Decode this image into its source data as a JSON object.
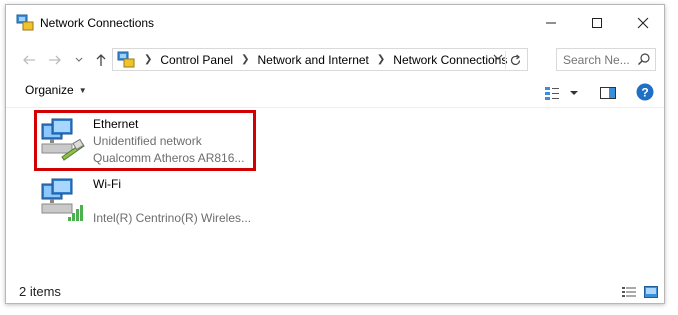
{
  "window": {
    "title": "Network Connections",
    "minimize_icon": "minimize-icon",
    "maximize_icon": "maximize-icon",
    "close_icon": "close-icon"
  },
  "navigation": {
    "back_icon": "arrow-left-icon",
    "forward_icon": "arrow-right-icon",
    "up_icon": "arrow-up-icon"
  },
  "address_bar": {
    "breadcrumbs": [
      "Control Panel",
      "Network and Internet",
      "Network Connections"
    ],
    "refresh_icon": "refresh-icon"
  },
  "search": {
    "placeholder": "Search Ne..."
  },
  "toolbar": {
    "organize_label": "Organize",
    "help_label": "?"
  },
  "connections": [
    {
      "name": "Ethernet",
      "status": "Unidentified network",
      "adapter": "Qualcomm Atheros AR816...",
      "icon": "ethernet-adapter-icon",
      "highlighted": true
    },
    {
      "name": "Wi-Fi",
      "status": "",
      "adapter": "Intel(R) Centrino(R) Wireles...",
      "icon": "wifi-adapter-icon",
      "highlighted": false
    }
  ],
  "status_bar": {
    "item_count": "2 items"
  },
  "colors": {
    "highlight": "#d20000",
    "help_blue": "#1f6fc5"
  }
}
